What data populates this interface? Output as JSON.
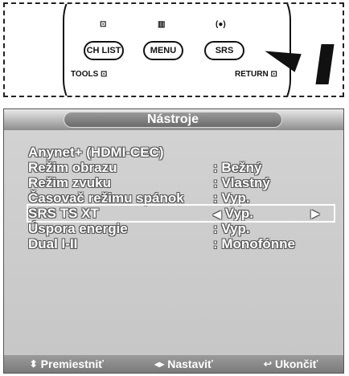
{
  "remote": {
    "buttons": {
      "ch_list": "CH LIST",
      "menu": "MENU",
      "srs": "SRS"
    },
    "labels": {
      "tools": "TOOLS",
      "return": "RETURN"
    },
    "icons": {
      "ch_list_icon": "⊡",
      "menu_icon": "▥",
      "srs_icon": "(●)",
      "tools_icon": "⊡",
      "return_icon": "⊡"
    }
  },
  "osd": {
    "title": "Nástroje",
    "items": [
      {
        "label": "Anynet+ (HDMI-CEC)",
        "value": ""
      },
      {
        "label": "Režim obrazu",
        "value": ": Bežný"
      },
      {
        "label": "Režim zvuku",
        "value": ": Vlastný"
      },
      {
        "label": "Časovač režimu spánok",
        "value": ": Vyp."
      },
      {
        "label": "SRS TS XT",
        "value": "Vyp."
      },
      {
        "label": "Úspora energie",
        "value": ": Vyp."
      },
      {
        "label": "Dual I-II",
        "value": ": Monofónne"
      }
    ],
    "footer": {
      "move": "Premiestniť",
      "adjust": "Nastaviť",
      "exit": "Ukončiť"
    }
  },
  "colors": {
    "panel_bg": "#c8c8c8",
    "header": "#8d8d8d",
    "text": "#ffffff"
  }
}
